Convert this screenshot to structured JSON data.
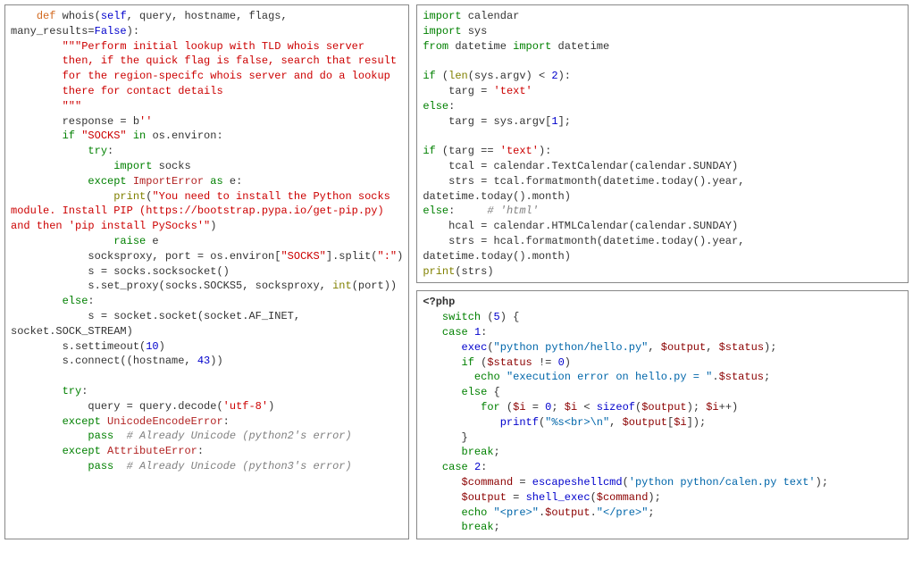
{
  "left": {
    "l1a": "def",
    "l1b": " whois(",
    "l1c": "self",
    "l1d": ", query, hostname, flags,",
    "l2a": "many_results",
    "l2b": "=",
    "l2c": "False",
    "l2d": "):",
    "l3": "\"\"\"Perform initial lookup with TLD whois server",
    "l4": "then, if the quick flag is false, search that result",
    "l5": "for the region-specifc whois server and do a lookup",
    "l6": "there for contact details",
    "l7": "\"\"\"",
    "l8a": "response ",
    "l8b": "=",
    "l8c": " b",
    "l8d": "''",
    "l9a": "if",
    "l9b": " ",
    "l9c": "\"SOCKS\"",
    "l9d": " ",
    "l9e": "in",
    "l9f": " os.environ:",
    "l10": "try",
    "l10b": ":",
    "l11a": "import",
    "l11b": " socks",
    "l12a": "except",
    "l12b": " ",
    "l12c": "ImportError",
    "l12d": " ",
    "l12e": "as",
    "l12f": " e:",
    "l13a": "print",
    "l13b": "(",
    "l13c": "\"You need to install the Python socks ",
    "l14": "module. Install PIP (https://bootstrap.pypa.io/get-pip.py) ",
    "l15": "and then 'pip install PySocks'\"",
    "l15b": ")",
    "l16a": "raise",
    "l16b": " e",
    "l17a": "socksproxy, port ",
    "l17b": "=",
    "l17c": " os.environ[",
    "l17d": "\"SOCKS\"",
    "l17e": "].split(",
    "l17f": "\":\"",
    "l17g": ")",
    "l18a": "s ",
    "l18b": "=",
    "l18c": " socks.socksocket()",
    "l19a": "s.set_proxy(socks.SOCKS5, socksproxy, ",
    "l19b": "int",
    "l19c": "(port))",
    "l20a": "else",
    "l20b": ":",
    "l21a": "s ",
    "l21b": "=",
    "l21c": " socket.socket(socket.AF_INET, ",
    "l22": "socket.SOCK_STREAM)",
    "l23a": "s.settimeout(",
    "l23b": "10",
    "l23c": ")",
    "l24a": "s.connect((hostname, ",
    "l24b": "43",
    "l24c": "))",
    "l25a": "try",
    "l25b": ":",
    "l26a": "query ",
    "l26b": "=",
    "l26c": " query.decode(",
    "l26d": "'utf-8'",
    "l26e": ")",
    "l27a": "except",
    "l27b": " ",
    "l27c": "UnicodeEncodeError",
    "l27d": ":",
    "l28a": "pass",
    "l28b": "  ",
    "l28c": "# Already Unicode (python2's error)",
    "l29a": "except",
    "l29b": " ",
    "l29c": "AttributeError",
    "l29d": ":",
    "l30a": "pass",
    "l30b": "  ",
    "l30c": "# Already Unicode (python3's error)"
  },
  "right_top": {
    "l1a": "import",
    "l1b": " calendar",
    "l2a": "import",
    "l2b": " sys",
    "l3a": "from",
    "l3b": " datetime ",
    "l3c": "import",
    "l3d": " datetime",
    "l5a": "if",
    "l5b": " (",
    "l5c": "len",
    "l5d": "(sys.argv) ",
    "l5e": "<",
    "l5f": " ",
    "l5g": "2",
    "l5h": "):",
    "l6a": "targ ",
    "l6b": "=",
    "l6c": " ",
    "l6d": "'text'",
    "l7a": "else",
    "l7b": ":",
    "l8a": "targ ",
    "l8b": "=",
    "l8c": " sys.argv[",
    "l8d": "1",
    "l8e": "];",
    "l10a": "if",
    "l10b": " (targ ",
    "l10c": "==",
    "l10d": " ",
    "l10e": "'text'",
    "l10f": "):",
    "l11a": "tcal ",
    "l11b": "=",
    "l11c": " calendar.TextCalendar(calendar.SUNDAY)",
    "l12a": "strs ",
    "l12b": "=",
    "l12c": " tcal.formatmonth(datetime.today().year, ",
    "l13": "datetime.today().month)",
    "l14a": "else",
    "l14b": ":     ",
    "l14c": "# 'html'",
    "l15a": "hcal ",
    "l15b": "=",
    "l15c": " calendar.HTMLCalendar(calendar.SUNDAY)",
    "l16a": "strs ",
    "l16b": "=",
    "l16c": " hcal.formatmonth(datetime.today().year, ",
    "l17": "datetime.today().month)",
    "l18a": "print",
    "l18b": "(strs)"
  },
  "right_bot": {
    "l1": "<?php",
    "l2a": "switch",
    "l2b": " (",
    "l2c": "5",
    "l2d": ") {",
    "l3a": "case",
    "l3b": " ",
    "l3c": "1",
    "l3d": ":",
    "l4a": "exec",
    "l4b": "(",
    "l4c": "\"python python/hello.py\"",
    "l4d": ", ",
    "l4e": "$output",
    "l4f": ", ",
    "l4g": "$status",
    "l4h": ");",
    "l5a": "if",
    "l5b": " (",
    "l5c": "$status",
    "l5d": " != ",
    "l5e": "0",
    "l5f": ")",
    "l6a": "echo",
    "l6b": " ",
    "l6c": "\"execution error on hello.py = \"",
    "l6d": ".",
    "l6e": "$status",
    "l6f": ";",
    "l7a": "else",
    "l7b": " {",
    "l8a": "for",
    "l8b": " (",
    "l8c": "$i",
    "l8d": " = ",
    "l8e": "0",
    "l8f": "; ",
    "l8g": "$i",
    "l8h": " < ",
    "l8i": "sizeof",
    "l8j": "(",
    "l8k": "$output",
    "l8l": "); ",
    "l8m": "$i",
    "l8n": "++)",
    "l9a": "printf",
    "l9b": "(",
    "l9c": "\"%s<br>\\n\"",
    "l9d": ", ",
    "l9e": "$output",
    "l9f": "[",
    "l9g": "$i",
    "l9h": "]);",
    "l10": "}",
    "l11a": "break",
    "l11b": ";",
    "l12a": "case",
    "l12b": " ",
    "l12c": "2",
    "l12d": ":",
    "l13a": "$command",
    "l13b": " = ",
    "l13c": "escapeshellcmd",
    "l13d": "(",
    "l13e": "'python python/calen.py text'",
    "l13f": ");",
    "l14a": "$output",
    "l14b": " = ",
    "l14c": "shell_exec",
    "l14d": "(",
    "l14e": "$command",
    "l14f": ");",
    "l15a": "echo",
    "l15b": " ",
    "l15c": "\"<pre>\"",
    "l15d": ".",
    "l15e": "$output",
    "l15f": ".",
    "l15g": "\"</pre>\"",
    "l15h": ";",
    "l16a": "break",
    "l16b": ";"
  }
}
